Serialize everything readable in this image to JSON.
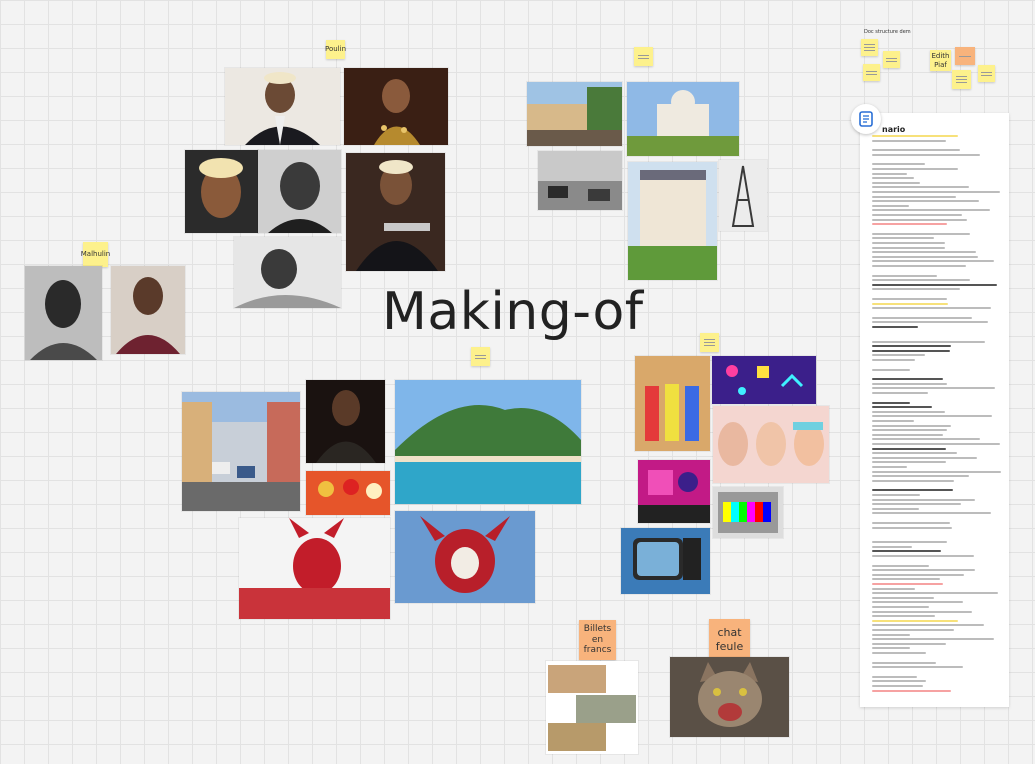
{
  "board": {
    "title": "Making-of"
  },
  "stickies": {
    "poulin": "Poulin",
    "malhulin": "Malhulin",
    "edith_piaf": "Edith Piaf",
    "billets": "Billets en francs",
    "chat": "chat feule"
  },
  "labels": {
    "top_right_small": "Doc structure dem"
  },
  "doc": {
    "title": "nario"
  },
  "colors": {
    "sticky_yellow": "#fdf18c",
    "sticky_orange": "#f8b37c",
    "background": "#f3f3f3",
    "doc_icon": "#2a6fd6"
  },
  "icons": {
    "doc_icon": "document-icon"
  }
}
